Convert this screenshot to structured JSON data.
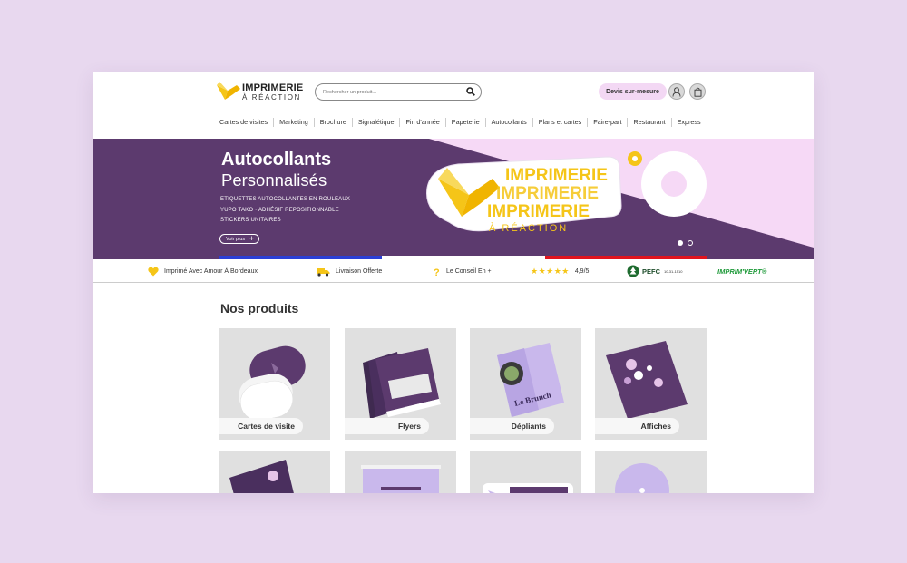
{
  "header": {
    "logo_line1": "IMPRIMERIE",
    "logo_line2": "À RÉACTION",
    "search_placeholder": "Rechercher un produit...",
    "devis_label": "Devis sur-mesure"
  },
  "nav": {
    "items": [
      "Cartes de visites",
      "Marketing",
      "Brochure",
      "Signalétique",
      "Fin d'année",
      "Papeterie",
      "Autocollants",
      "Plans et cartes",
      "Faire-part",
      "Restaurant",
      "Express"
    ]
  },
  "hero": {
    "title": "Autocollants",
    "subtitle": "Personnalisés",
    "lines": [
      "ETIQUETTES AUTOCOLLANTES EN ROULEAUX",
      "YUPO TAKO · ADHÉSIF REPOSITIONNABLE",
      "STICKERS UNITAIRES"
    ],
    "button_label": "Voir plus",
    "sticker_line1": "IMPRIMERIE",
    "sticker_line2": "À RÉACTION",
    "slide_active": 1,
    "slide_total": 2
  },
  "trust": {
    "made_label": "Imprimé Avec Amour À Bordeaux",
    "delivery_label": "Livraison Offerte",
    "advice_label": "Le Conseil En +",
    "rating_value": "4,9/5",
    "rating_stars": 5,
    "pefc_label": "PEFC",
    "pefc_code": "10-31-1510",
    "imprimvert_label": "IMPRIM'VERT®"
  },
  "products": {
    "title": "Nos produits",
    "row1": [
      "Cartes de visite",
      "Flyers",
      "Dépliants",
      "Affiches"
    ]
  },
  "colors": {
    "accent_purple": "#5c3a6e",
    "light_pink": "#f6d9f6",
    "logo_yellow": "#f5c518",
    "flag_blue": "#2b3fd6",
    "flag_red": "#e0141e"
  }
}
